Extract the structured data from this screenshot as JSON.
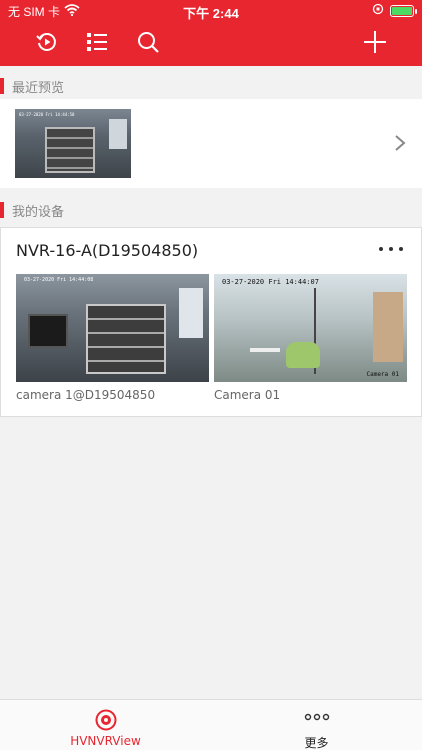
{
  "status_bar": {
    "carrier": "无 SIM 卡",
    "time": "下午 2:44"
  },
  "sections": {
    "recent_title": "最近预览",
    "devices_title": "我的设备"
  },
  "recent": {
    "thumb_timestamp": "03-27-2020 Fri 14:44:50"
  },
  "device": {
    "name": "NVR-16-A(D19504850)",
    "cameras": [
      {
        "name": "camera 1@D19504850",
        "timestamp": "03-27-2020 Fri 14:44:08"
      },
      {
        "name": "Camera 01",
        "timestamp": "03-27-2020 Fri 14:44:07",
        "overlay_label": "Camera 01"
      }
    ]
  },
  "tabs": [
    {
      "label": "HVNVRView",
      "active": true,
      "icon": "camera-lens-icon"
    },
    {
      "label": "更多",
      "active": false,
      "icon": "more-dots-icon"
    }
  ],
  "colors": {
    "accent": "#e8262f",
    "background": "#f2f2f2"
  }
}
